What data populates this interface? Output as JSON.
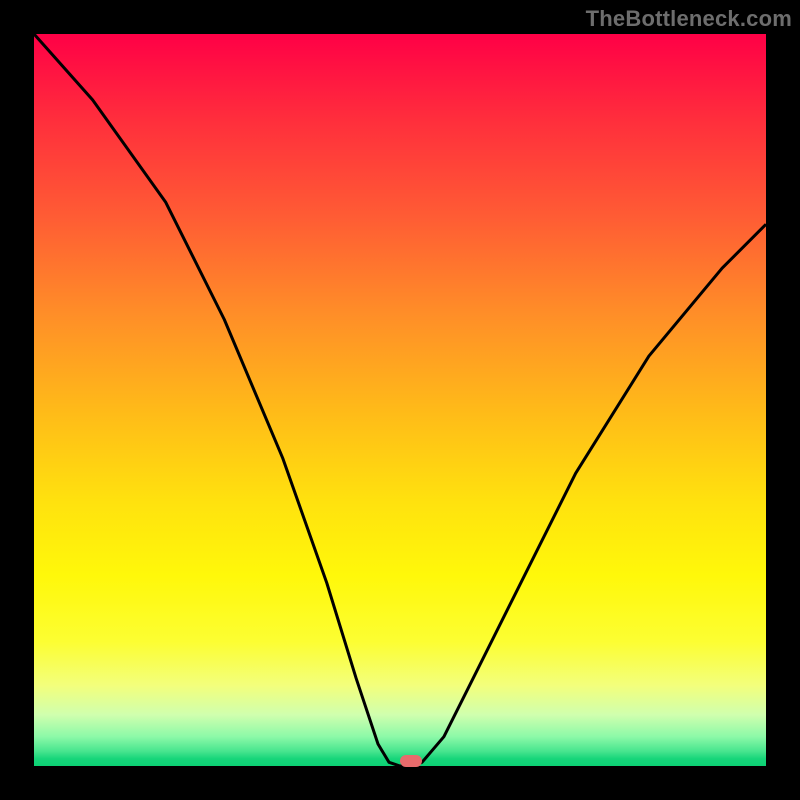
{
  "watermark": "TheBottleneck.com",
  "marker": {
    "color": "#e86b6c"
  },
  "chart_data": {
    "type": "line",
    "title": "",
    "xlabel": "",
    "ylabel": "",
    "xlim": [
      0,
      100
    ],
    "ylim": [
      0,
      100
    ],
    "grid": false,
    "legend": false,
    "gradient_colors_top_to_bottom": [
      "#ff0046",
      "#ffe20e",
      "#0cd274"
    ],
    "series": [
      {
        "name": "curve",
        "x": [
          0,
          8,
          18,
          26,
          34,
          40,
          44,
          47,
          48.5,
          50,
          51.5,
          53,
          56,
          60,
          66,
          74,
          84,
          94,
          100
        ],
        "y": [
          100,
          91,
          77,
          61,
          42,
          25,
          12,
          3,
          0.5,
          0,
          0,
          0.5,
          4,
          12,
          24,
          40,
          56,
          68,
          74
        ]
      }
    ],
    "marker": {
      "x": 51.5,
      "y": 0.7
    }
  }
}
